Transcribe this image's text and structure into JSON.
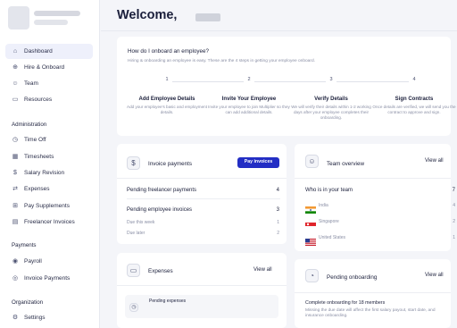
{
  "welcome": {
    "greeting": "Welcome,"
  },
  "sidebar": {
    "items": [
      {
        "label": "Dashboard",
        "icon": "home-icon",
        "glyph": "⌂"
      },
      {
        "label": "Hire & Onboard",
        "icon": "user-plus-icon",
        "glyph": "⊕"
      },
      {
        "label": "Team",
        "icon": "team-icon",
        "glyph": "☺"
      },
      {
        "label": "Resources",
        "icon": "folder-icon",
        "glyph": "▭"
      }
    ],
    "administration": {
      "title": "Administration",
      "items": [
        {
          "label": "Time Off",
          "icon": "clock-icon",
          "glyph": "◷"
        },
        {
          "label": "Timesheets",
          "icon": "timesheet-icon",
          "glyph": "▦"
        },
        {
          "label": "Salary Revision",
          "icon": "salary-icon",
          "glyph": "$"
        },
        {
          "label": "Expenses",
          "icon": "expenses-icon",
          "glyph": "⇄"
        },
        {
          "label": "Pay Supplements",
          "icon": "supplements-icon",
          "glyph": "⊞"
        },
        {
          "label": "Freelancer Invoices",
          "icon": "invoice-icon",
          "glyph": "▤"
        }
      ]
    },
    "payments": {
      "title": "Payments",
      "items": [
        {
          "label": "Payroll",
          "icon": "payroll-icon",
          "glyph": "◉"
        },
        {
          "label": "Invoice Payments",
          "icon": "invoice-payments-icon",
          "glyph": "◎"
        }
      ]
    },
    "organization": {
      "title": "Organization",
      "items": [
        {
          "label": "Settings",
          "icon": "gear-icon",
          "glyph": "⚙"
        }
      ]
    }
  },
  "onboarding": {
    "title": "How do I onboard an employee?",
    "subtitle": "Hiring & onboarding an employee is easy. These are the 4 steps in getting your employee onboard.",
    "steps": [
      {
        "num": "1",
        "title": "Add Employee Details",
        "desc": "Add your employee's basic and employment details."
      },
      {
        "num": "2",
        "title": "Invite Your Employee",
        "desc": "Invite your employee to join Multiplier so they can add additional details."
      },
      {
        "num": "3",
        "title": "Verify Details",
        "desc": "We will verify their details within 1-2 working days after your employee completes their onboarding."
      },
      {
        "num": "4",
        "title": "Sign Contracts",
        "desc": "Once details are verified, we will send you the contract to approve and sign."
      }
    ]
  },
  "invoices": {
    "title": "Invoice payments",
    "button": "Pay invoices",
    "freelancer_label": "Pending freelancer payments",
    "freelancer_count": "4",
    "employee_label": "Pending employee invoices",
    "employee_count": "3",
    "due_week_label": "Due this week",
    "due_week_count": "1",
    "due_later_label": "Due later",
    "due_later_count": "2"
  },
  "team": {
    "title": "Team overview",
    "view_all": "View all",
    "who_label": "Who is in your team",
    "who_count": "7",
    "countries": [
      {
        "name": "India",
        "count": "4"
      },
      {
        "name": "Singapore",
        "count": "2"
      },
      {
        "name": "United States",
        "count": "1"
      }
    ]
  },
  "expenses": {
    "title": "Expenses",
    "view_all": "View all",
    "pending_label": "Pending expenses"
  },
  "pending_onboarding": {
    "title": "Pending onboarding",
    "view_all": "View all",
    "headline": "Complete onboarding for 18 members",
    "desc": "Missing the due date will affect the first salary payout, start date, and insurance onboarding."
  },
  "colors": {
    "primary": "#232ec4",
    "accent_bg": "#eef0fb"
  }
}
